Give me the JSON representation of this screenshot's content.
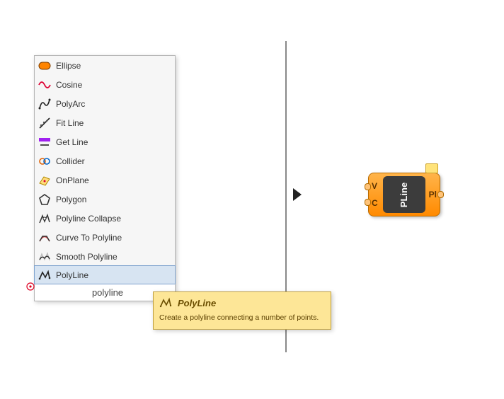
{
  "menu": {
    "items": [
      {
        "label": "Ellipse"
      },
      {
        "label": "Cosine"
      },
      {
        "label": "PolyArc"
      },
      {
        "label": "Fit Line"
      },
      {
        "label": "Get Line"
      },
      {
        "label": "Collider"
      },
      {
        "label": "OnPlane"
      },
      {
        "label": "Polygon"
      },
      {
        "label": "Polyline Collapse"
      },
      {
        "label": "Curve To Polyline"
      },
      {
        "label": "Smooth Polyline"
      },
      {
        "label": "PolyLine"
      }
    ],
    "search_value": "polyline"
  },
  "tooltip": {
    "title": "PolyLine",
    "description": "Create a polyline connecting a number of points."
  },
  "node": {
    "name": "PLine",
    "inputs": [
      {
        "label": "V"
      },
      {
        "label": "C"
      }
    ],
    "outputs": [
      {
        "label": "Pl"
      }
    ]
  }
}
